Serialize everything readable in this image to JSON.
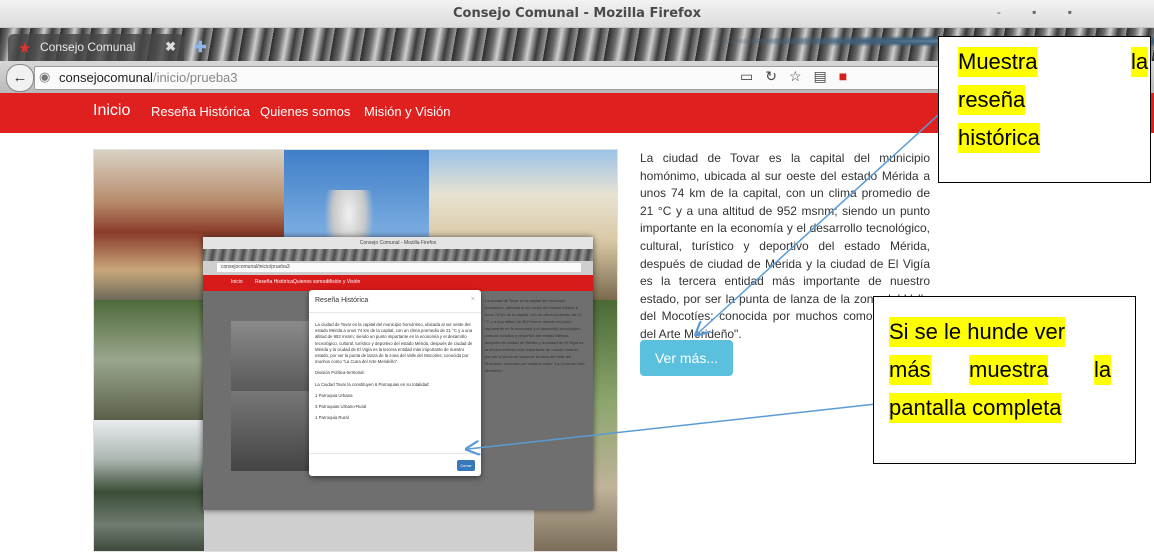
{
  "window": {
    "title": "Consejo Comunal - Mozilla Firefox",
    "controls": "- ▪ ▪"
  },
  "tab": {
    "label": "Consejo Comunal",
    "close": "✖",
    "newtab": "✚"
  },
  "address": {
    "host": "consejocomunal",
    "path": "/inicio/prueba3"
  },
  "nav": {
    "home": "Inicio",
    "items": [
      "Reseña Histórica",
      "Quienes somos",
      "Misión y Visión"
    ]
  },
  "content": {
    "history_text": "La ciudad de Tovar es la capital del municipio homónimo, ubicada al sur oeste del estado Mérida a unos 74 km de la capital, con un clima promedio de 21 °C y a una altitud de 952 msnm; siendo un punto importante en la economía y el desarrollo tecnológico, cultural, turístico y deportivo del estado Mérida, después de ciudad de Mérida y la ciudad de El Vigía es la tercera entidad más importante de nuestro estado, por ser la punta de lanza de la zona del Valle del Mocotíes; conocida por muchos como \"La Cuna del Arte Merideño\".",
    "button": "Ver más..."
  },
  "nested": {
    "title": "Consejo Comunal - Mozilla Firefox",
    "url": "consejocomunal/inicio/prueba3",
    "nav": [
      "Inicio",
      "Reseña Histórica",
      "Quienes somos",
      "Misión y Visión"
    ],
    "side_text": "La ciudad de Tovar es la capital del municipio homónimo, ubicada al sur oeste del estado Mérida a unos 74 km de la capital, con un clima promedio de 21 °C y a una altitud de 952 msnm; siendo un punto importante en la economía y el desarrollo tecnológico, cultural, turístico y deportivo del estado Mérida, después de ciudad de Mérida y la ciudad de El Vigía es la tercera entidad más importante de nuestro estado, por ser la punta de lanza de la zona del Valle del Mocotíes; conocida por muchos como \"La Cuna del Arte Merideño\".",
    "modal": {
      "title": "Reseña Histórica",
      "close": "×",
      "paragraph": "La ciudad de Tovar es la capital del municipio homónimo, ubicada al sur oeste del estado Mérida a unos 74 km de la capital, con un clima promedio de 21 °C y a una altitud de 952 msnm; siendo un punto importante en la economía y el desarrollo tecnológico, cultural, turístico y deportivo del estado Mérida, después de ciudad de Mérida y la ciudad de El Vigía es la tercera entidad más importante de nuestro estado, por ser la punta de lanza de la zona del Valle del Mocotíes; conocida por muchos como \"La Cuna del Arte Merideño\".",
      "division": "División Política-territorial:",
      "parroquias": "La Ciudad Tovar la constituyen 6 Parroquias en su totalidad:",
      "items": [
        "1 Parroquia Urbana",
        "3 Parroquias Urbano-Rural",
        "1 Parroquia Rural"
      ],
      "button": "Cerrar"
    }
  },
  "callouts": {
    "first": [
      "Muestra",
      "la",
      "reseña",
      "histórica"
    ],
    "second": [
      "Si se le hunde ver",
      "más",
      "muestra",
      "la",
      "pantalla completa"
    ]
  },
  "colors": {
    "nav_red": "#e0201e",
    "button_blue": "#5bc0de",
    "highlight": "#ffff00",
    "arrow": "#5b9bd5"
  }
}
